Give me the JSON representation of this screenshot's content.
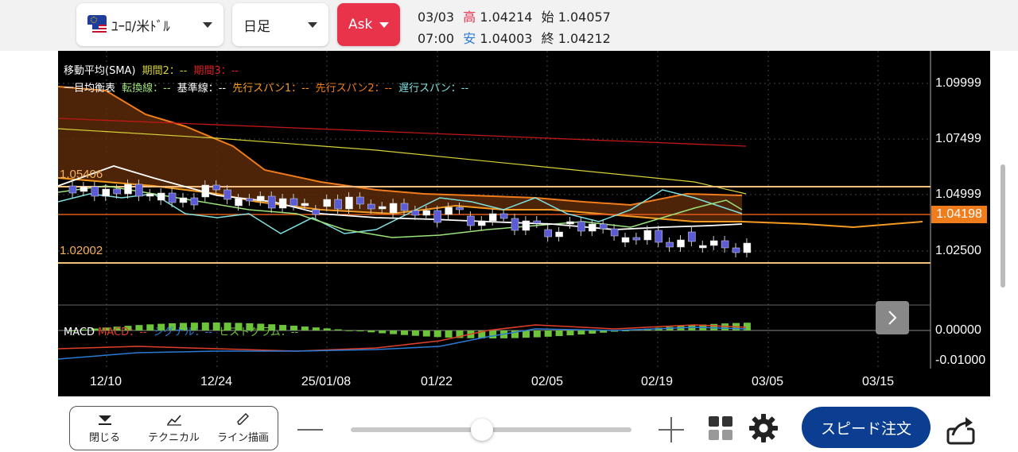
{
  "toolbar": {
    "pair_label": "ﾕｰﾛ/米ﾄﾞﾙ",
    "period_label": "日足",
    "side_label": "Ask"
  },
  "ohlc": {
    "date": "03/03",
    "time": "07:00",
    "high_label": "高",
    "high": "1.04214",
    "open_label": "始",
    "open": "1.04057",
    "low_label": "安",
    "low": "1.04003",
    "close_label": "終",
    "close": "1.04212"
  },
  "legend": {
    "sma_title": "移動平均(SMA)",
    "sma_p2": "期間2：--",
    "sma_p3": "期間3：--",
    "ichimoku_title": "一目均衡表",
    "tenkan": "転換線：--",
    "kijun": "基準線：--",
    "senkou1": "先行スパン1：--",
    "senkou2": "先行スパン2：--",
    "chikou": "遅行スパン：--",
    "macd_title": "MACD",
    "macd": "MACD：--",
    "signal": "シグナル：--",
    "histogram": "ヒストグラム：--"
  },
  "chart_data": {
    "type": "candlestick",
    "price_axis_labels": [
      "1.09999",
      "1.07499",
      "1.04999",
      "1.02500"
    ],
    "macd_axis_labels": [
      "0.00000",
      "-0.01000"
    ],
    "date_labels": [
      "12/10",
      "12/24",
      "25/01/08",
      "01/22",
      "02/05",
      "02/19",
      "03/05",
      "03/15"
    ],
    "current_price": "1.04198",
    "high_line_label": "1.05406",
    "low_line_label": "1.02002",
    "colors": {
      "up_candle": "#ffffff",
      "down_candle": "#5b5bd6",
      "cloud": "#5a2a08",
      "tenkan": "#9be37a",
      "kijun": "#ffffff",
      "senkou1": "#f59a23",
      "senkou2": "#f07c1c",
      "chikou": "#7fe0e0",
      "sma2": "#d6d23a",
      "sma3": "#c01818",
      "macd": "#e0402a",
      "signal": "#2a7bd4",
      "histogram": "#6dc43a"
    }
  },
  "bottom": {
    "close_label": "閉じる",
    "technical_label": "テクニカル",
    "line_label": "ライン描画",
    "order_label": "スピード注文"
  }
}
